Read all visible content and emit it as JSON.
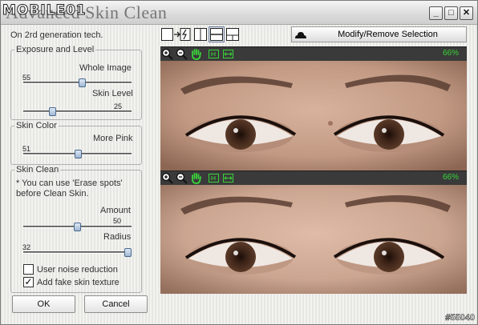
{
  "window": {
    "title": "Advanced Skin Clean",
    "watermark": "MOBILE01",
    "min_glyph": "_",
    "max_glyph": "□",
    "close_glyph": "✕",
    "subtitle": "On 2rd generation tech."
  },
  "exposure": {
    "legend": "Exposure and Level",
    "whole_label": "Whole Image",
    "whole_value": "55",
    "whole_level": 0.55,
    "skin_label": "Skin Level",
    "skin_value": "25",
    "skin_level": 0.25
  },
  "skin_color": {
    "legend": "Skin Color",
    "pink_label": "More Pink",
    "pink_value": "51",
    "pink_level": 0.51
  },
  "skin_clean": {
    "legend": "Skin Clean",
    "note": "* You can use 'Erase spots' before Clean Skin.",
    "amount_label": "Amount",
    "amount_value": "50",
    "amount_level": 0.5,
    "radius_label": "Radius",
    "radius_value": "32",
    "radius_level": 1.0,
    "noise_label": "User noise reduction",
    "noise_checked": false,
    "texture_label": "Add fake skin texture",
    "texture_checked": true
  },
  "buttons": {
    "ok": "OK",
    "cancel": "Cancel"
  },
  "toolbar": {
    "modify_label": "Modify/Remove Selection"
  },
  "preview": {
    "zoom_top": "66%",
    "zoom_bottom": "66%"
  },
  "footer": {
    "watermark": "#55040"
  },
  "colors": {
    "accent_green": "#37d537",
    "dark_bar": "#3a3a3a",
    "skin": "#c9a08a"
  }
}
